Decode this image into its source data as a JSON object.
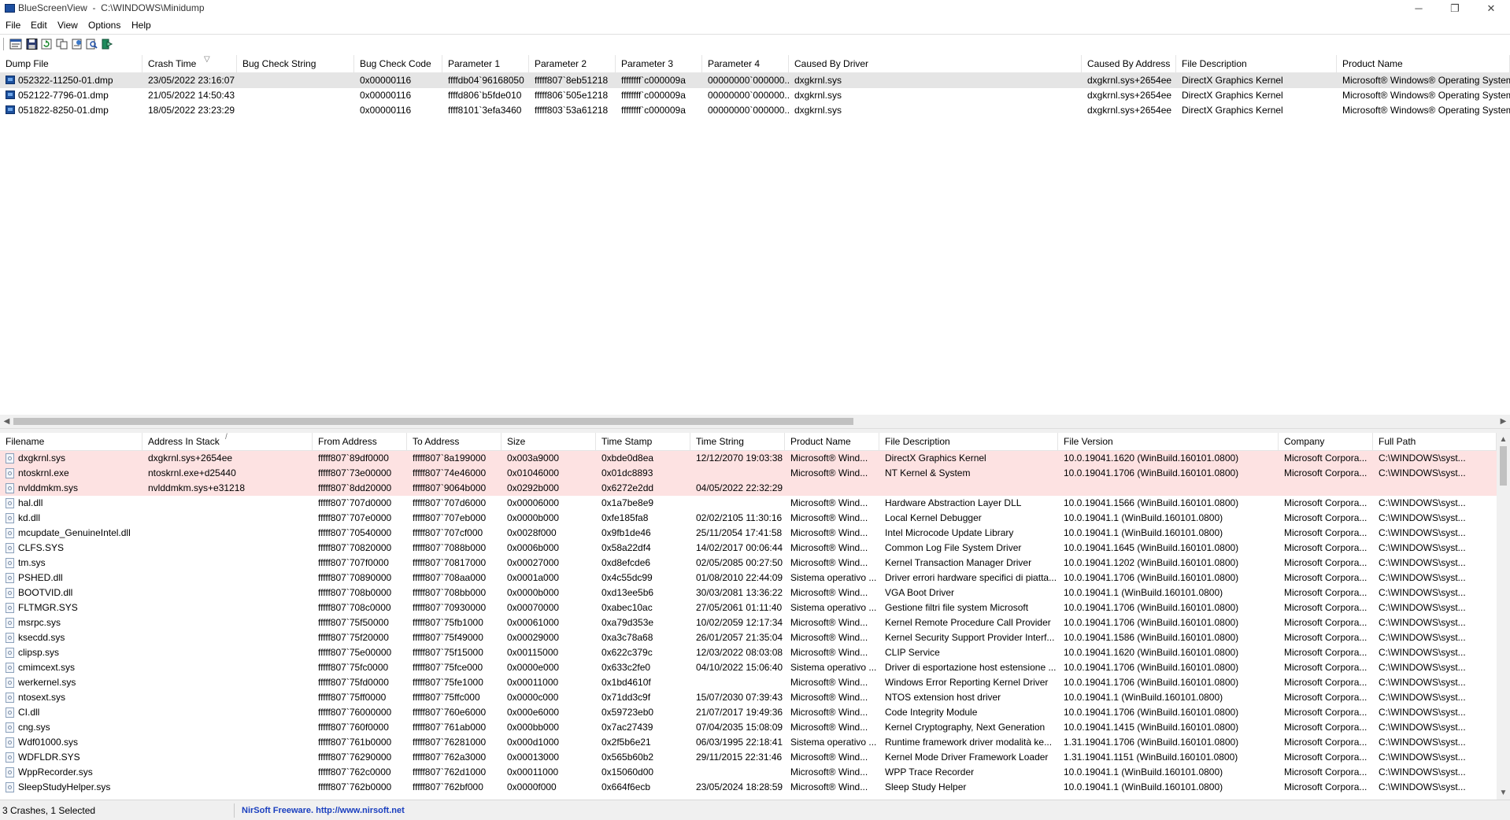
{
  "window": {
    "title": "BlueScreenView  -  C:\\WINDOWS\\Minidump",
    "minimize_glyph": "─",
    "restore_glyph": "❐",
    "close_glyph": "✕"
  },
  "menu": [
    "File",
    "Edit",
    "View",
    "Options",
    "Help"
  ],
  "toolbar": {
    "buttons": [
      "properties-icon",
      "save-icon",
      "refresh-icon",
      "copy-icon",
      "html-report-icon",
      "find-icon",
      "exit-icon"
    ]
  },
  "crash_list": {
    "columns": [
      "Dump File",
      "Crash Time",
      "Bug Check String",
      "Bug Check Code",
      "Parameter 1",
      "Parameter 2",
      "Parameter 3",
      "Parameter 4",
      "Caused By Driver",
      "Caused By Address",
      "File Description",
      "Product Name"
    ],
    "sort_indicator": "▽",
    "rows": [
      [
        "052322-11250-01.dmp",
        "23/05/2022 23:16:07",
        "",
        "0x00000116",
        "ffffdb04`96168050",
        "fffff807`8eb51218",
        "ffffffff`c000009a",
        "00000000`000000...",
        "dxgkrnl.sys",
        "dxgkrnl.sys+2654ee",
        "DirectX Graphics Kernel",
        "Microsoft® Windows® Operating System"
      ],
      [
        "052122-7796-01.dmp",
        "21/05/2022 14:50:43",
        "",
        "0x00000116",
        "ffffd806`b5fde010",
        "fffff806`505e1218",
        "ffffffff`c000009a",
        "00000000`000000...",
        "dxgkrnl.sys",
        "dxgkrnl.sys+2654ee",
        "DirectX Graphics Kernel",
        "Microsoft® Windows® Operating System"
      ],
      [
        "051822-8250-01.dmp",
        "18/05/2022 23:23:29",
        "",
        "0x00000116",
        "ffff8101`3efa3460",
        "fffff803`53a61218",
        "ffffffff`c000009a",
        "00000000`000000...",
        "dxgkrnl.sys",
        "dxgkrnl.sys+2654ee",
        "DirectX Graphics Kernel",
        "Microsoft® Windows® Operating System"
      ]
    ],
    "hscroll_left": "◀",
    "hscroll_right": "▶"
  },
  "driver_list": {
    "columns": [
      "Filename",
      "Address In Stack",
      "From Address",
      "To Address",
      "Size",
      "Time Stamp",
      "Time String",
      "Product Name",
      "File Description",
      "File Version",
      "Company",
      "Full Path"
    ],
    "sort_indicator": "/",
    "rows": [
      [
        "dxgkrnl.sys",
        "dxgkrnl.sys+2654ee",
        "fffff807`89df0000",
        "fffff807`8a199000",
        "0x003a9000",
        "0xbde0d8ea",
        "12/12/2070 19:03:38",
        "Microsoft® Wind...",
        "DirectX Graphics Kernel",
        "10.0.19041.1620 (WinBuild.160101.0800)",
        "Microsoft Corpora...",
        "C:\\WINDOWS\\syst..."
      ],
      [
        "ntoskrnl.exe",
        "ntoskrnl.exe+d25440",
        "fffff807`73e00000",
        "fffff807`74e46000",
        "0x01046000",
        "0x01dc8893",
        "",
        "Microsoft® Wind...",
        "NT Kernel & System",
        "10.0.19041.1706 (WinBuild.160101.0800)",
        "Microsoft Corpora...",
        "C:\\WINDOWS\\syst..."
      ],
      [
        "nvlddmkm.sys",
        "nvlddmkm.sys+e31218",
        "fffff807`8dd20000",
        "fffff807`9064b000",
        "0x0292b000",
        "0x6272e2dd",
        "04/05/2022 22:32:29",
        "",
        "",
        "",
        "",
        ""
      ],
      [
        "hal.dll",
        "",
        "fffff807`707d0000",
        "fffff807`707d6000",
        "0x00006000",
        "0x1a7be8e9",
        "",
        "Microsoft® Wind...",
        "Hardware Abstraction Layer DLL",
        "10.0.19041.1566 (WinBuild.160101.0800)",
        "Microsoft Corpora...",
        "C:\\WINDOWS\\syst..."
      ],
      [
        "kd.dll",
        "",
        "fffff807`707e0000",
        "fffff807`707eb000",
        "0x0000b000",
        "0xfe185fa8",
        "02/02/2105 11:30:16",
        "Microsoft® Wind...",
        "Local Kernel Debugger",
        "10.0.19041.1 (WinBuild.160101.0800)",
        "Microsoft Corpora...",
        "C:\\WINDOWS\\syst..."
      ],
      [
        "mcupdate_GenuineIntel.dll",
        "",
        "fffff807`70540000",
        "fffff807`707cf000",
        "0x0028f000",
        "0x9fb1de46",
        "25/11/2054 17:41:58",
        "Microsoft® Wind...",
        "Intel Microcode Update Library",
        "10.0.19041.1 (WinBuild.160101.0800)",
        "Microsoft Corpora...",
        "C:\\WINDOWS\\syst..."
      ],
      [
        "CLFS.SYS",
        "",
        "fffff807`70820000",
        "fffff807`7088b000",
        "0x0006b000",
        "0x58a22df4",
        "14/02/2017 00:06:44",
        "Microsoft® Wind...",
        "Common Log File System Driver",
        "10.0.19041.1645 (WinBuild.160101.0800)",
        "Microsoft Corpora...",
        "C:\\WINDOWS\\syst..."
      ],
      [
        "tm.sys",
        "",
        "fffff807`707f0000",
        "fffff807`70817000",
        "0x00027000",
        "0xd8efcde6",
        "02/05/2085 00:27:50",
        "Microsoft® Wind...",
        "Kernel Transaction Manager Driver",
        "10.0.19041.1202 (WinBuild.160101.0800)",
        "Microsoft Corpora...",
        "C:\\WINDOWS\\syst..."
      ],
      [
        "PSHED.dll",
        "",
        "fffff807`70890000",
        "fffff807`708aa000",
        "0x0001a000",
        "0x4c55dc99",
        "01/08/2010 22:44:09",
        "Sistema operativo ...",
        "Driver errori hardware specifici di piatta...",
        "10.0.19041.1706 (WinBuild.160101.0800)",
        "Microsoft Corpora...",
        "C:\\WINDOWS\\syst..."
      ],
      [
        "BOOTVID.dll",
        "",
        "fffff807`708b0000",
        "fffff807`708bb000",
        "0x0000b000",
        "0xd13ee5b6",
        "30/03/2081 13:36:22",
        "Microsoft® Wind...",
        "VGA Boot Driver",
        "10.0.19041.1 (WinBuild.160101.0800)",
        "Microsoft Corpora...",
        "C:\\WINDOWS\\syst..."
      ],
      [
        "FLTMGR.SYS",
        "",
        "fffff807`708c0000",
        "fffff807`70930000",
        "0x00070000",
        "0xabec10ac",
        "27/05/2061 01:11:40",
        "Sistema operativo ...",
        "Gestione filtri file system Microsoft",
        "10.0.19041.1706 (WinBuild.160101.0800)",
        "Microsoft Corpora...",
        "C:\\WINDOWS\\syst..."
      ],
      [
        "msrpc.sys",
        "",
        "fffff807`75f50000",
        "fffff807`75fb1000",
        "0x00061000",
        "0xa79d353e",
        "10/02/2059 12:17:34",
        "Microsoft® Wind...",
        "Kernel Remote Procedure Call Provider",
        "10.0.19041.1706 (WinBuild.160101.0800)",
        "Microsoft Corpora...",
        "C:\\WINDOWS\\syst..."
      ],
      [
        "ksecdd.sys",
        "",
        "fffff807`75f20000",
        "fffff807`75f49000",
        "0x00029000",
        "0xa3c78a68",
        "26/01/2057 21:35:04",
        "Microsoft® Wind...",
        "Kernel Security Support Provider Interf...",
        "10.0.19041.1586 (WinBuild.160101.0800)",
        "Microsoft Corpora...",
        "C:\\WINDOWS\\syst..."
      ],
      [
        "clipsp.sys",
        "",
        "fffff807`75e00000",
        "fffff807`75f15000",
        "0x00115000",
        "0x622c379c",
        "12/03/2022 08:03:08",
        "Microsoft® Wind...",
        "CLIP Service",
        "10.0.19041.1620 (WinBuild.160101.0800)",
        "Microsoft Corpora...",
        "C:\\WINDOWS\\syst..."
      ],
      [
        "cmimcext.sys",
        "",
        "fffff807`75fc0000",
        "fffff807`75fce000",
        "0x0000e000",
        "0x633c2fe0",
        "04/10/2022 15:06:40",
        "Sistema operativo ...",
        "Driver di esportazione host estensione ...",
        "10.0.19041.1706 (WinBuild.160101.0800)",
        "Microsoft Corpora...",
        "C:\\WINDOWS\\syst..."
      ],
      [
        "werkernel.sys",
        "",
        "fffff807`75fd0000",
        "fffff807`75fe1000",
        "0x00011000",
        "0x1bd4610f",
        "",
        "Microsoft® Wind...",
        "Windows Error Reporting Kernel Driver",
        "10.0.19041.1706 (WinBuild.160101.0800)",
        "Microsoft Corpora...",
        "C:\\WINDOWS\\syst..."
      ],
      [
        "ntosext.sys",
        "",
        "fffff807`75ff0000",
        "fffff807`75ffc000",
        "0x0000c000",
        "0x71dd3c9f",
        "15/07/2030 07:39:43",
        "Microsoft® Wind...",
        "NTOS extension host driver",
        "10.0.19041.1 (WinBuild.160101.0800)",
        "Microsoft Corpora...",
        "C:\\WINDOWS\\syst..."
      ],
      [
        "CI.dll",
        "",
        "fffff807`76000000",
        "fffff807`760e6000",
        "0x000e6000",
        "0x59723eb0",
        "21/07/2017 19:49:36",
        "Microsoft® Wind...",
        "Code Integrity Module",
        "10.0.19041.1706 (WinBuild.160101.0800)",
        "Microsoft Corpora...",
        "C:\\WINDOWS\\syst..."
      ],
      [
        "cng.sys",
        "",
        "fffff807`760f0000",
        "fffff807`761ab000",
        "0x000bb000",
        "0x7ac27439",
        "07/04/2035 15:08:09",
        "Microsoft® Wind...",
        "Kernel Cryptography, Next Generation",
        "10.0.19041.1415 (WinBuild.160101.0800)",
        "Microsoft Corpora...",
        "C:\\WINDOWS\\syst..."
      ],
      [
        "Wdf01000.sys",
        "",
        "fffff807`761b0000",
        "fffff807`76281000",
        "0x000d1000",
        "0x2f5b6e21",
        "06/03/1995 22:18:41",
        "Sistema operativo ...",
        "Runtime framework driver modalità ke...",
        "1.31.19041.1706 (WinBuild.160101.0800)",
        "Microsoft Corpora...",
        "C:\\WINDOWS\\syst..."
      ],
      [
        "WDFLDR.SYS",
        "",
        "fffff807`76290000",
        "fffff807`762a3000",
        "0x00013000",
        "0x565b60b2",
        "29/11/2015 22:31:46",
        "Microsoft® Wind...",
        "Kernel Mode Driver Framework Loader",
        "1.31.19041.1151 (WinBuild.160101.0800)",
        "Microsoft Corpora...",
        "C:\\WINDOWS\\syst..."
      ],
      [
        "WppRecorder.sys",
        "",
        "fffff807`762c0000",
        "fffff807`762d1000",
        "0x00011000",
        "0x15060d00",
        "",
        "Microsoft® Wind...",
        "WPP Trace Recorder",
        "10.0.19041.1 (WinBuild.160101.0800)",
        "Microsoft Corpora...",
        "C:\\WINDOWS\\syst..."
      ],
      [
        "SleepStudyHelper.sys",
        "",
        "fffff807`762b0000",
        "fffff807`762bf000",
        "0x0000f000",
        "0x664f6ecb",
        "23/05/2024 18:28:59",
        "Microsoft® Wind...",
        "Sleep Study Helper",
        "10.0.19041.1 (WinBuild.160101.0800)",
        "Microsoft Corpora...",
        "C:\\WINDOWS\\syst..."
      ]
    ],
    "vscroll_up": "▲",
    "vscroll_down": "▼"
  },
  "statusbar": {
    "summary": "3 Crashes, 1 Selected",
    "link_text": "NirSoft Freeware.  http://www.nirsoft.net"
  },
  "colors": {
    "selected_row": "#e5e5e5",
    "highlight_row": "#fde2e2",
    "link": "#1a3fbf"
  }
}
